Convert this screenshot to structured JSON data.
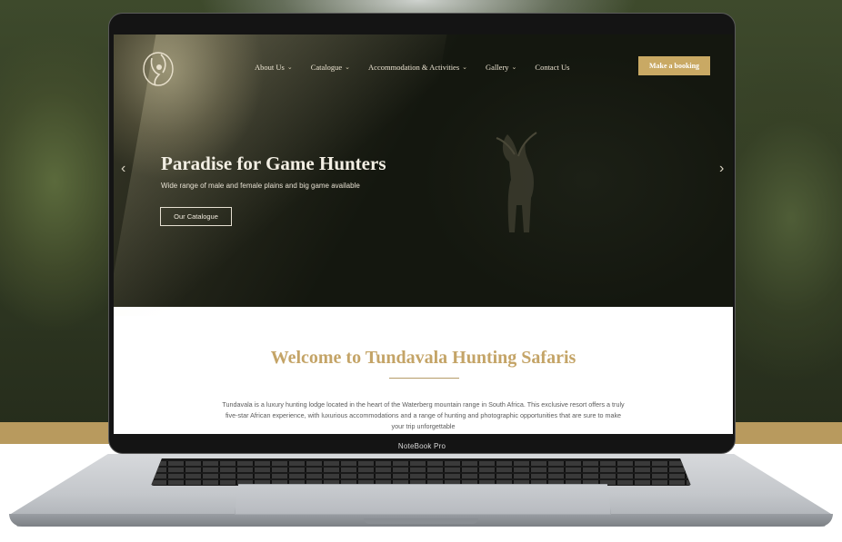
{
  "device": {
    "chin_label": "NoteBook Pro"
  },
  "site": {
    "nav": [
      {
        "label": "About Us",
        "has_dropdown": true
      },
      {
        "label": "Catalogue",
        "has_dropdown": true
      },
      {
        "label": "Accommodation & Activities",
        "has_dropdown": true
      },
      {
        "label": "Gallery",
        "has_dropdown": true
      },
      {
        "label": "Contact Us",
        "has_dropdown": false
      }
    ],
    "booking_label": "Make a booking",
    "hero": {
      "title": "Paradise for Game Hunters",
      "subtitle": "Wide range of male and female plains and big game available",
      "cta_label": "Our Catalogue",
      "prev_glyph": "‹",
      "next_glyph": "›"
    },
    "welcome": {
      "title": "Welcome to Tundavala Hunting Safaris",
      "body": "Tundavala is a luxury hunting lodge located in the heart of the Waterberg mountain range in South Africa. This exclusive resort offers a truly five-star African experience, with luxurious accommodations and a range of hunting and photographic opportunities that are sure to make your trip unforgettable"
    },
    "caret_glyph": "⌄"
  },
  "colors": {
    "accent_gold": "#c9a964",
    "welcome_title": "#c4a467",
    "band_gold": "#b89a5e"
  },
  "icons": {
    "logo": "animal-crest-logo",
    "prev": "chevron-left-icon",
    "next": "chevron-right-icon"
  }
}
